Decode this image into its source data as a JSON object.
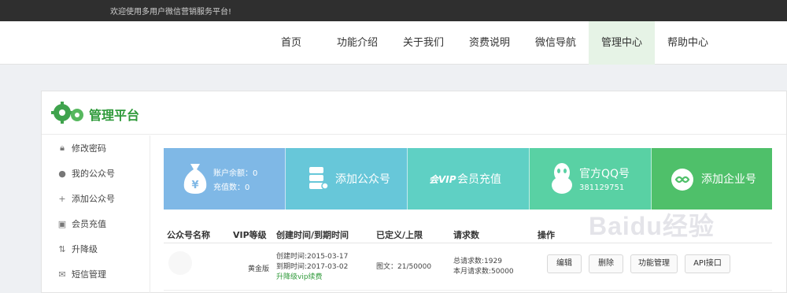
{
  "topbar": {
    "welcome": "欢迎使用多用户微信营销服务平台!"
  },
  "nav": {
    "items": [
      "首页",
      "功能介绍",
      "关于我们",
      "资费说明",
      "微信导航",
      "管理中心",
      "帮助中心"
    ],
    "active_index": 5
  },
  "panel": {
    "title": "管理平台"
  },
  "sidebar": {
    "items": [
      {
        "label": "修改密码",
        "icon": "lock-icon"
      },
      {
        "label": "我的公众号",
        "icon": "user-icon"
      },
      {
        "label": "添加公众号",
        "icon": "plus-icon"
      },
      {
        "label": "会员充值",
        "icon": "wallet-icon"
      },
      {
        "label": "升降级",
        "icon": "sort-icon"
      },
      {
        "label": "短信管理",
        "icon": "envelope-icon"
      }
    ]
  },
  "cards": {
    "balance": {
      "label": "账户余额：0",
      "sub": "充值数：0",
      "color": "#7fb8e6",
      "icon": "money-bag-icon"
    },
    "add_account": {
      "label": "添加公众号",
      "color": "#67c7d9",
      "icon": "stack-icon"
    },
    "recharge": {
      "label": "会员充值",
      "color": "#5fd0c4",
      "icon": "vip-icon"
    },
    "qq": {
      "label": "官方QQ号",
      "sub": "381129751",
      "color": "#59d1a4",
      "icon": "qq-penguin-icon"
    },
    "enterprise": {
      "label": "添加企业号",
      "color": "#4fc06a",
      "icon": "link-icon"
    }
  },
  "table": {
    "headers": [
      "公众号名称",
      "VIP等级",
      "创建时间/到期时间",
      "已定义/上限",
      "请求数",
      "操作"
    ],
    "row": {
      "vip": "黄金版",
      "created": "创建时间:2015-03-17",
      "expires": "到期时间:2017-03-02",
      "upgrade_link": "升降级vip续费",
      "defined": "图文：21/50000",
      "total_requests": "总请求数:1929",
      "month_requests": "本月请求数:50000",
      "actions": [
        "编辑",
        "删除",
        "功能管理",
        "API接口"
      ]
    }
  },
  "watermark": {
    "text": "Baidu经验"
  }
}
